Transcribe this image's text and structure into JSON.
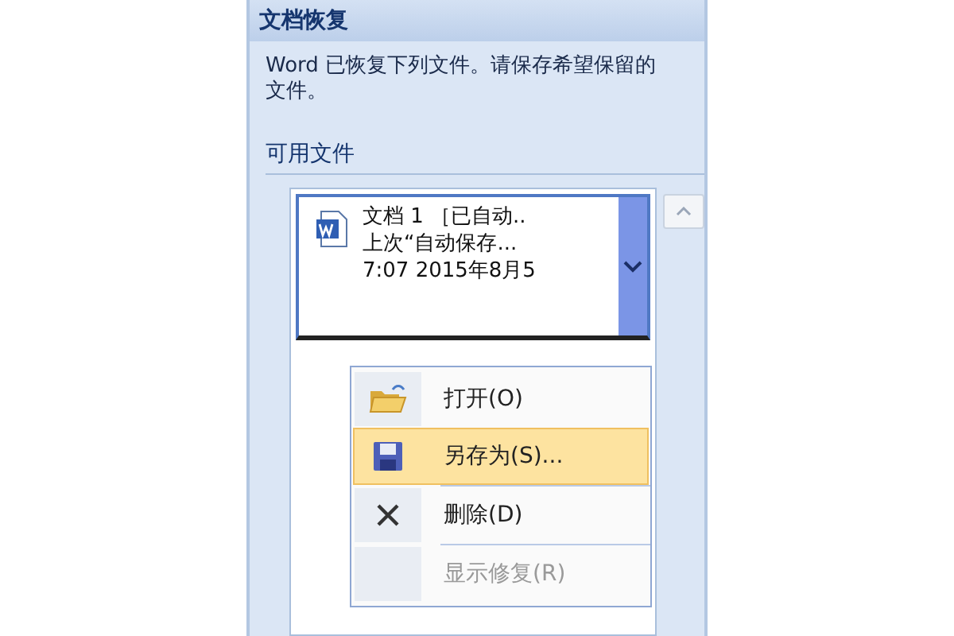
{
  "panel": {
    "title": "文档恢复",
    "message": "Word 已恢复下列文件。请保存希望保留的文件。",
    "section_label": "可用文件"
  },
  "files": [
    {
      "lines": [
        "文档 1 ［已自动..",
        "上次“自动保存...",
        "7:07 2015年8月5"
      ],
      "selected": true
    }
  ],
  "context_menu": [
    {
      "kind": "open",
      "label": "打开(O)",
      "highlighted": false,
      "disabled": false
    },
    {
      "kind": "save",
      "label": "另存为(S)...",
      "highlighted": true,
      "disabled": false
    },
    {
      "kind": "delete",
      "label": "删除(D)",
      "highlighted": false,
      "disabled": false
    },
    {
      "kind": "none",
      "label": "显示修复(R)",
      "highlighted": false,
      "disabled": true
    }
  ]
}
